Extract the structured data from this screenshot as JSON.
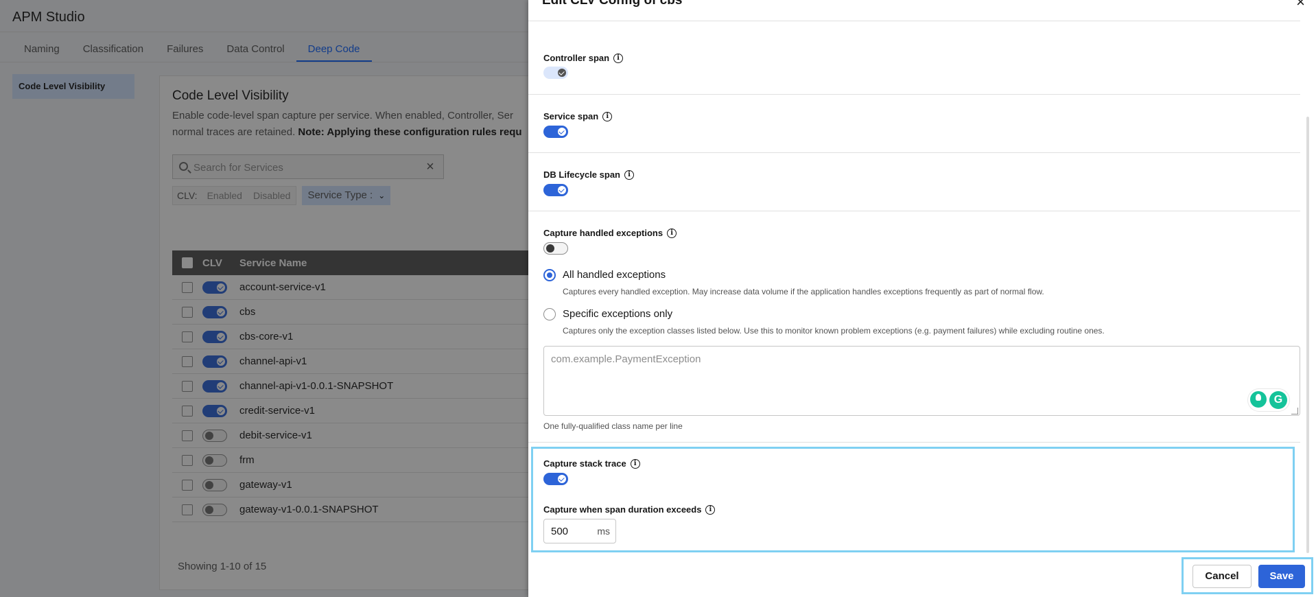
{
  "app": {
    "title": "APM Studio",
    "tabs": [
      {
        "label": "Naming"
      },
      {
        "label": "Classification"
      },
      {
        "label": "Failures"
      },
      {
        "label": "Data Control"
      },
      {
        "label": "Deep Code",
        "active": true
      }
    ],
    "sidebar": {
      "items": [
        {
          "label": "Code Level Visibility",
          "active": true
        }
      ]
    }
  },
  "clv_page": {
    "title": "Code Level Visibility",
    "description": "Enable code-level span capture per service. When enabled, Controller, Ser",
    "description_line2": "normal traces are retained. ",
    "description_bold": "Note: Applying these configuration rules requ",
    "search": {
      "placeholder": "Search for Services",
      "value": ""
    },
    "filter": {
      "label": "CLV:",
      "options": [
        "Enabled",
        "Disabled"
      ]
    },
    "service_type": {
      "label": "Service Type :"
    },
    "table": {
      "headers": {
        "clv": "CLV",
        "name": "Service Name"
      },
      "rows": [
        {
          "name": "account-service-v1",
          "clv": true
        },
        {
          "name": "cbs",
          "clv": true
        },
        {
          "name": "cbs-core-v1",
          "clv": true
        },
        {
          "name": "channel-api-v1",
          "clv": true
        },
        {
          "name": "channel-api-v1-0.0.1-SNAPSHOT",
          "clv": true
        },
        {
          "name": "credit-service-v1",
          "clv": true
        },
        {
          "name": "debit-service-v1",
          "clv": false
        },
        {
          "name": "frm",
          "clv": false
        },
        {
          "name": "gateway-v1",
          "clv": false
        },
        {
          "name": "gateway-v1-0.0.1-SNAPSHOT",
          "clv": false
        }
      ]
    },
    "pagination": "Showing 1-10 of 15"
  },
  "drawer": {
    "title": "Edit CLV Config of cbs",
    "fields": {
      "controller_span": {
        "label": "Controller span",
        "state": "on-disabled"
      },
      "service_span": {
        "label": "Service span",
        "state": "on"
      },
      "db_lifecycle_span": {
        "label": "DB Lifecycle span",
        "state": "on"
      },
      "capture_handled": {
        "label": "Capture handled exceptions",
        "state": "off"
      },
      "all_handled": {
        "label": "All handled exceptions",
        "help": "Captures every handled exception. May increase data volume if the application handles exceptions frequently as part of normal flow.",
        "selected": true
      },
      "specific": {
        "label": "Specific exceptions only",
        "help": "Captures only the exception classes listed below. Use this to monitor known problem exceptions (e.g. payment failures) while excluding routine ones.",
        "selected": false
      },
      "exceptions_textarea": {
        "placeholder": "com.example.PaymentException",
        "value": "",
        "help": "One fully-qualified class name per line"
      },
      "capture_stack_trace": {
        "label": "Capture stack trace",
        "state": "on"
      },
      "span_duration": {
        "label": "Capture when span duration exceeds",
        "value": "500",
        "unit": "ms"
      }
    },
    "buttons": {
      "cancel": "Cancel",
      "save": "Save"
    }
  },
  "colors": {
    "accent": "#2d64d8",
    "highlight": "#7fd0f2",
    "header_dark": "#525252"
  },
  "icons": [
    "search-icon",
    "clear-icon",
    "chevron-down-icon",
    "close-icon",
    "info-icon",
    "checkmark-icon",
    "grammarly-icon"
  ]
}
